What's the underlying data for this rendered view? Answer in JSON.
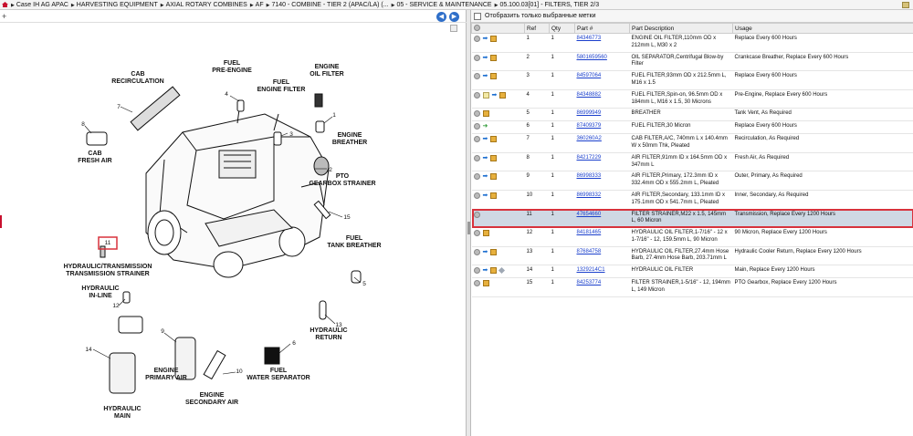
{
  "breadcrumbs": [
    "Case IH AG APAC",
    "HARVESTING EQUIPMENT",
    "AXIAL ROTARY COMBINES",
    "AF",
    "7140 - COMBINE - TIER 2 (APAC/LA) (...",
    "05 - SERVICE & MAINTENANCE",
    "05.100.03[01] - FILTERS, TIER 2/3"
  ],
  "left_toolbar": {
    "plus": "+",
    "prev": "◀",
    "next": "▶"
  },
  "diagram_labels": {
    "cab_recirc": [
      "CAB",
      "RECIRCULATION"
    ],
    "fuel_pre": [
      "FUEL",
      "PRE-ENGINE"
    ],
    "engine_oil": [
      "ENGINE",
      "OIL FILTER"
    ],
    "fuel_engine": [
      "FUEL",
      "ENGINE FILTER"
    ],
    "engine_breather": [
      "ENGINE",
      "BREATHER"
    ],
    "cab_fresh": [
      "CAB",
      "FRESH AIR"
    ],
    "pto_strainer": [
      "PTO",
      "GEARBOX STRAINER"
    ],
    "fuel_tank": [
      "FUEL",
      "TANK BREATHER"
    ],
    "hyd_trans": [
      "HYDRAULIC/TRANSMISSION",
      "TRANSMISSION STRAINER"
    ],
    "hyd_inline": [
      "HYDRAULIC",
      "IN-LINE"
    ],
    "hyd_return": [
      "HYDRAULIC",
      "RETURN"
    ],
    "engine_primary": [
      "ENGINE",
      "PRIMARY AIR"
    ],
    "engine_secondary": [
      "ENGINE",
      "SECONDARY AIR"
    ],
    "fuel_water": [
      "FUEL",
      "WATER SEPARATOR"
    ],
    "hyd_main": [
      "HYDRAULIC",
      "MAIN"
    ]
  },
  "diagram_numbers": [
    "1",
    "2",
    "3",
    "4",
    "5",
    "6",
    "7",
    "8",
    "9",
    "10",
    "11",
    "12",
    "13",
    "14",
    "15"
  ],
  "filter_label": "Отобразить только выбранные метки",
  "columns": [
    "Ref",
    "Qty",
    "Part #",
    "Part Description",
    "Usage"
  ],
  "rows": [
    {
      "ref": "1",
      "qty": "1",
      "part": "84346773",
      "desc": "ENGINE OIL FILTER,110mm OD x 212mm L, M30 x 2",
      "usage": "Replace Every 600 Hours",
      "icons": [
        "gear",
        "arrow",
        "box"
      ]
    },
    {
      "ref": "2",
      "qty": "1",
      "part": "5801659560",
      "desc": "OIL SEPARATOR,Centrifugal Blow-by Filter",
      "usage": "Crankcase Breather, Replace Every 600 Hours",
      "icons": [
        "gear",
        "arrow",
        "box"
      ]
    },
    {
      "ref": "3",
      "qty": "1",
      "part": "84597064",
      "desc": "FUEL FILTER,93mm OD x 212.5mm L, M16 x 1.5",
      "usage": "Replace Every 600 Hours",
      "icons": [
        "gear",
        "arrow",
        "box"
      ]
    },
    {
      "ref": "4",
      "qty": "1",
      "part": "84348882",
      "desc": "FUEL FILTER,Spin-on, 96.5mm OD x 184mm L, M16 x 1.5, 30 Microns",
      "usage": "Pre-Engine, Replace Every 600 Hours",
      "icons": [
        "gear",
        "note",
        "arrow",
        "box"
      ]
    },
    {
      "ref": "5",
      "qty": "1",
      "part": "86999949",
      "desc": "BREATHER",
      "usage": "Tank Vent, As Required",
      "icons": [
        "gear",
        "box"
      ]
    },
    {
      "ref": "6",
      "qty": "1",
      "part": "87409379",
      "desc": "FUEL FILTER,30 Micron",
      "usage": "Replace Every 600 Hours",
      "icons": [
        "gear",
        "green"
      ]
    },
    {
      "ref": "7",
      "qty": "1",
      "part": "360260A2",
      "desc": "CAB FILTER,A/C, 740mm L x 140.4mm W x 50mm Thk, Pleated",
      "usage": "Recirculation, As Required",
      "icons": [
        "gear",
        "arrow",
        "box"
      ]
    },
    {
      "ref": "8",
      "qty": "1",
      "part": "84217229",
      "desc": "AIR FILTER,91mm ID x 164.5mm OD x 347mm L",
      "usage": "Fresh Air, As Required",
      "icons": [
        "gear",
        "arrow",
        "box"
      ]
    },
    {
      "ref": "9",
      "qty": "1",
      "part": "86998333",
      "desc": "AIR FILTER,Primary, 172.3mm ID x 332.4mm OD x 555.2mm L, Pleated",
      "usage": "Outer, Primary, As Required",
      "icons": [
        "gear",
        "arrow",
        "box"
      ]
    },
    {
      "ref": "10",
      "qty": "1",
      "part": "86998332",
      "desc": "AIR FILTER,Secondary, 133.1mm ID x 175.1mm OD x 541.7mm L, Pleated",
      "usage": "Inner, Secondary, As Required",
      "icons": [
        "gear",
        "arrow",
        "box"
      ]
    },
    {
      "ref": "11",
      "qty": "1",
      "part": "47654660",
      "desc": "FILTER STRAINER,M22 x 1.5, 145mm L, 60 Micron",
      "usage": "Transmission, Replace Every 1200 Hours",
      "icons": [
        "gear"
      ],
      "selected": true
    },
    {
      "ref": "12",
      "qty": "1",
      "part": "84181465",
      "desc": "HYDRAULIC OIL FILTER,1-7/16\" - 12 x 1-7/16\" - 12, 159.5mm L, 90 Micron",
      "usage": "90 Micron, Replace Every 1200 Hours",
      "icons": [
        "gear",
        "box"
      ]
    },
    {
      "ref": "13",
      "qty": "1",
      "part": "87684758",
      "desc": "HYDRAULIC OIL FILTER,27.4mm Hose Barb, 27.4mm Hose Barb, 203.71mm L",
      "usage": "Hydraulic Cooler Return, Replace Every 1200 Hours",
      "icons": [
        "gear",
        "arrow",
        "box"
      ]
    },
    {
      "ref": "14",
      "qty": "1",
      "part": "1329214C1",
      "desc": "HYDRAULIC OIL FILTER",
      "usage": "Main, Replace Every 1200 Hours",
      "icons": [
        "gear",
        "arrow",
        "box",
        "tool"
      ]
    },
    {
      "ref": "15",
      "qty": "1",
      "part": "84253774",
      "desc": "FILTER STRAINER,1-5/16\" - 12, 194mm L, 149 Micron",
      "usage": "PTO Gearbox, Replace Every 1200 Hours",
      "icons": [
        "gear",
        "box"
      ]
    }
  ]
}
